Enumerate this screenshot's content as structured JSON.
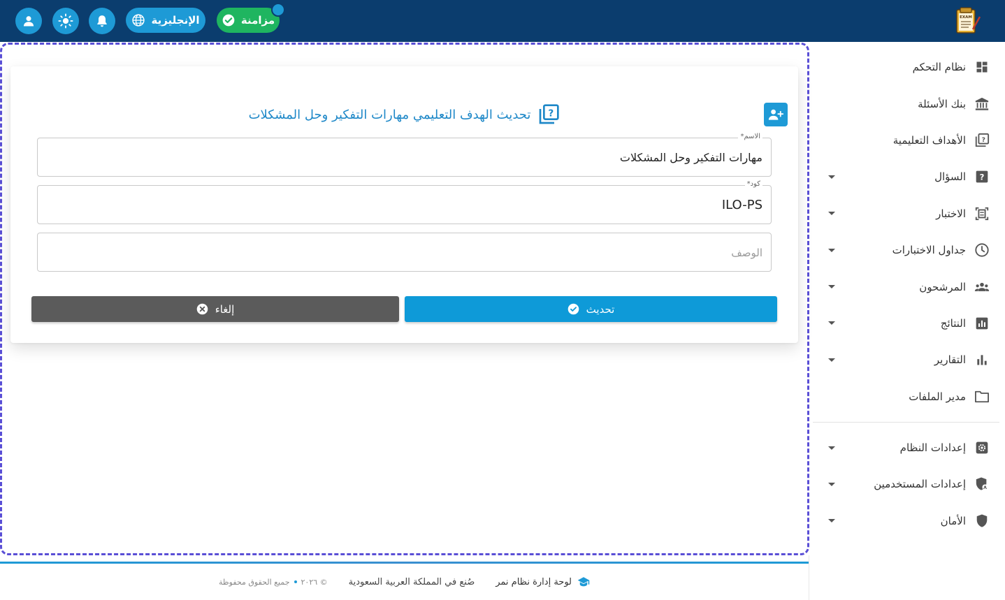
{
  "topbar": {
    "sync_label": "مزامنة",
    "language_label": "الإنجليزية",
    "icons": [
      "user-icon",
      "sun-icon",
      "bell-icon",
      "globe-icon",
      "check-circle-icon"
    ],
    "logo_text": "EXAM"
  },
  "sidebar": {
    "items": [
      {
        "label": "نظام التحكم",
        "icon": "dashboard-icon",
        "has_caret": false
      },
      {
        "label": "بنك الأسئلة",
        "icon": "bank-icon",
        "has_caret": false
      },
      {
        "label": "الأهداف التعليمية",
        "icon": "question-book-icon",
        "has_caret": false
      },
      {
        "label": "السؤال",
        "icon": "question-icon",
        "has_caret": true
      },
      {
        "label": "الاختبار",
        "icon": "exam-icon",
        "has_caret": true
      },
      {
        "label": "جداول الاختبارات",
        "icon": "clock-icon",
        "has_caret": true
      },
      {
        "label": "المرشحون",
        "icon": "group-icon",
        "has_caret": true
      },
      {
        "label": "النتائج",
        "icon": "results-icon",
        "has_caret": true
      },
      {
        "label": "التقارير",
        "icon": "bar-chart-icon",
        "has_caret": true
      },
      {
        "label": "مدير الملفات",
        "icon": "folder-icon",
        "has_caret": false
      },
      {
        "label": "إعدادات النظام",
        "icon": "settings-icon",
        "has_caret": true
      },
      {
        "label": "إعدادات المستخدمين",
        "icon": "user-shield-icon",
        "has_caret": true
      },
      {
        "label": "الأمان",
        "icon": "shield-icon",
        "has_caret": true
      }
    ]
  },
  "form": {
    "title": "تحديث الهدف التعليمي مهارات التفكير وحل المشكلات",
    "name_label": "الاسم*",
    "name_value": "مهارات التفكير وحل المشكلات",
    "code_label": "كود*",
    "code_value": "ILO-PS",
    "description_placeholder": "الوصف",
    "update_label": "تحديث",
    "cancel_label": "إلغاء"
  },
  "footer": {
    "brand": "لوحة إدارة نظام نمر",
    "made_in": "صُنع في المملكة العربية السعودية",
    "copyright": "© ٢٠٢٦",
    "rights": "جميع الحقوق محفوظة"
  },
  "colors": {
    "topbar": "#0b3d6e",
    "accent": "#1e9ad6",
    "sync": "#1fb560",
    "cancel": "#5b5b5b",
    "frame": "#5a4fd6"
  }
}
